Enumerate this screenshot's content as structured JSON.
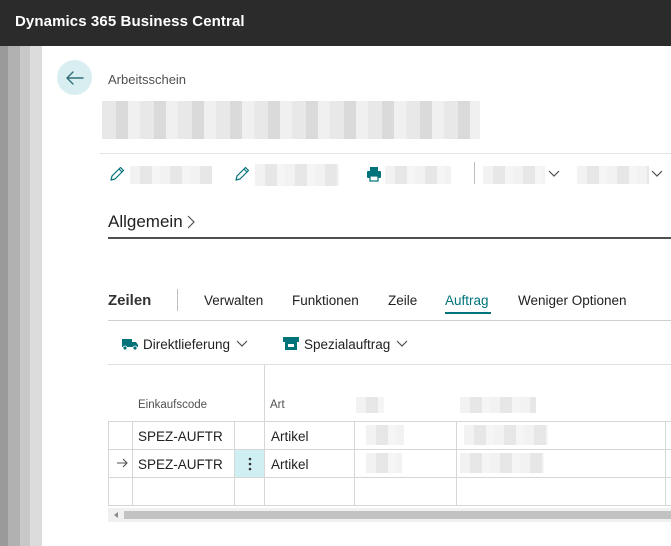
{
  "app": {
    "title": "Dynamics 365 Business Central"
  },
  "page": {
    "breadcrumb": "Arbeitsschein"
  },
  "sections": {
    "general": "Allgemein"
  },
  "lines": {
    "title": "Zeilen",
    "menu": [
      "Verwalten",
      "Funktionen",
      "Zeile",
      "Auftrag",
      "Weniger Optionen"
    ],
    "actions": {
      "drop_shipment": "Direktlieferung",
      "special_order": "Spezialauftrag"
    },
    "columns": {
      "purchasing_code": "Einkaufscode",
      "type": "Art"
    },
    "rows": [
      {
        "purchasing_code": "SPEZ-AUFTR",
        "type": "Artikel"
      },
      {
        "purchasing_code": "SPEZ-AUFTR",
        "type": "Artikel"
      }
    ]
  },
  "colors": {
    "accent": "#00727a",
    "topbar": "#2b2b2b"
  }
}
